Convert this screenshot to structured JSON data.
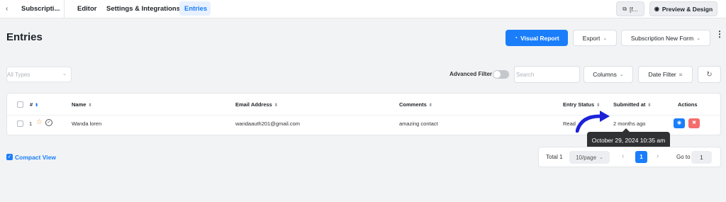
{
  "topbar": {
    "back_icon": "chevron-left-icon",
    "form_title": "Subscripti...",
    "tabs": [
      {
        "label": "Editor"
      },
      {
        "label": "Settings & Integrations"
      },
      {
        "label": "Entries"
      }
    ],
    "shortcode_label": "[f...",
    "preview_label": "Preview & Design"
  },
  "header": {
    "title": "Entries",
    "visual_report_label": "Visual Report",
    "export_label": "Export",
    "form_select_label": "Subscription New Form"
  },
  "filters": {
    "types_placeholder": "All Types",
    "advanced_filter_label": "Advanced Filter",
    "advanced_filter_on": false,
    "search_placeholder": "Search",
    "columns_label": "Columns",
    "date_filter_label": "Date Filter"
  },
  "table": {
    "headers": {
      "id": "#",
      "name": "Name",
      "email": "Email Address",
      "comments": "Comments",
      "status": "Entry Status",
      "submitted": "Submitted at",
      "actions": "Actions"
    },
    "rows": [
      {
        "id": "1",
        "name": "Wanda loren",
        "email": "wandaauth201@gmail.com",
        "comments": "amazing contact",
        "status": "Read",
        "submitted": "2 months ago"
      }
    ]
  },
  "tooltip": {
    "text": "October 29, 2024 10:35 am"
  },
  "footer": {
    "compact_view_label": "Compact View",
    "compact_view_checked": true,
    "total_label": "Total 1",
    "page_size_label": "10/page",
    "current_page": "1",
    "goto_label": "Go to",
    "goto_value": "1"
  },
  "colors": {
    "primary": "#1a7efb",
    "danger": "#f56c6c",
    "annotation_arrow": "#1d22d8",
    "tooltip_bg": "#303133"
  }
}
